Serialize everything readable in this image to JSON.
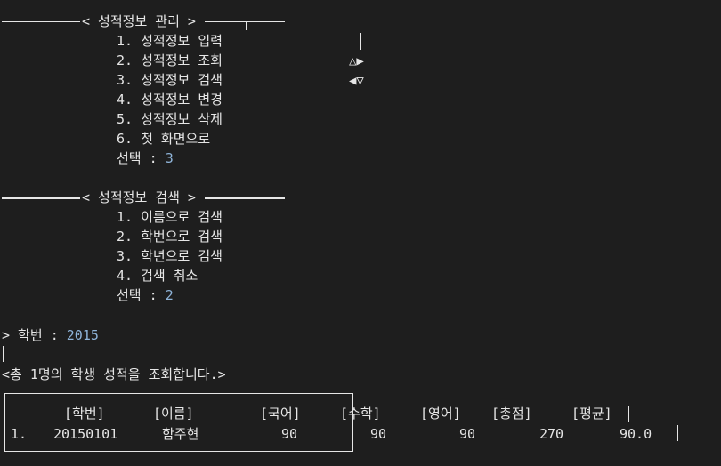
{
  "menu1": {
    "title": "< 성적정보 관리 >",
    "items": [
      "1. 성적정보 입력",
      "2. 성적정보 조회",
      "3. 성적정보 검색",
      "4. 성적정보 변경",
      "5. 성적정보 삭제",
      "6. 첫 화면으로"
    ],
    "select_label": "선택 : ",
    "select_value": "3"
  },
  "side_glyphs": {
    "row1": "△▶",
    "row2": "◀▽"
  },
  "menu2": {
    "title": "< 성적정보 검색 >",
    "items": [
      "1. 이름으로 검색",
      "2. 학번으로 검색",
      "3. 학년으로 검색",
      "4. 검색 취소"
    ],
    "select_label": "선택 : ",
    "select_value": "2"
  },
  "query": {
    "prompt": "> 학번 : ",
    "value": "2015"
  },
  "result_message": "<총 1명의 학생 성적을 조회합니다.>",
  "table": {
    "headers": [
      "[학번]",
      "[이름]",
      "[국어]",
      "[수학]",
      "[영어]",
      "[총점]",
      "[평균]"
    ],
    "rows": [
      {
        "index": "1.",
        "cells": [
          "20150101",
          "함주현",
          "90",
          "90",
          "90",
          "270",
          "90.0"
        ]
      }
    ]
  }
}
